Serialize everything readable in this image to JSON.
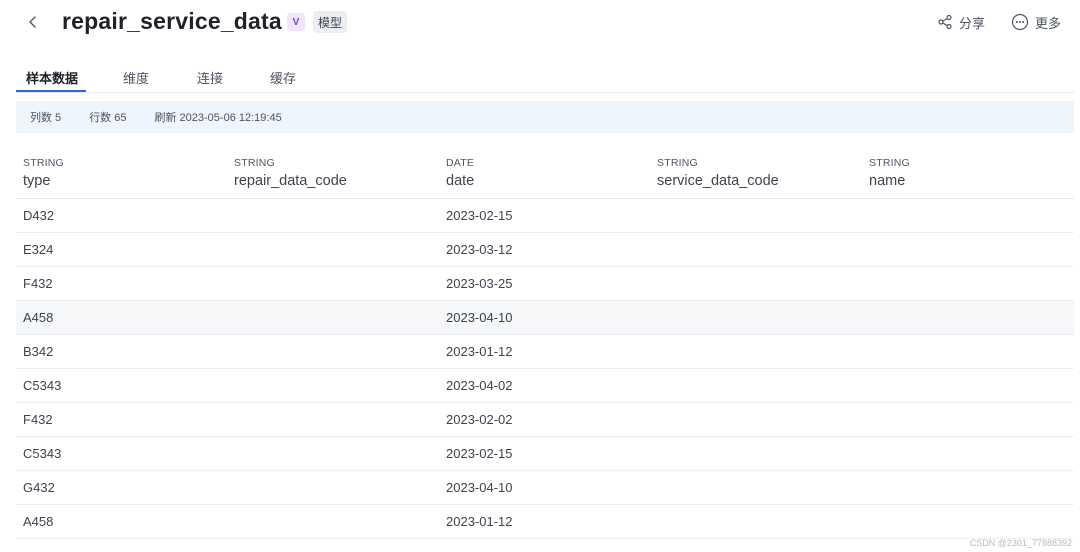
{
  "header": {
    "back_icon": "chevron-left-icon",
    "title": "repair_service_data",
    "badge": "V",
    "tag": "模型",
    "share_label": "分享",
    "share_icon": "share-icon",
    "more_label": "更多",
    "more_icon": "more-circle-icon"
  },
  "tabs": [
    {
      "label": "样本数据",
      "active": true
    },
    {
      "label": "维度",
      "active": false
    },
    {
      "label": "连接",
      "active": false
    },
    {
      "label": "缓存",
      "active": false
    }
  ],
  "info": {
    "columns": "列数 5",
    "rows": "行数 65",
    "refresh": "刷新 2023-05-06 12:19:45"
  },
  "table": {
    "columns": [
      {
        "type": "STRING",
        "name": "type"
      },
      {
        "type": "STRING",
        "name": "repair_data_code"
      },
      {
        "type": "DATE",
        "name": "date"
      },
      {
        "type": "STRING",
        "name": "service_data_code"
      },
      {
        "type": "STRING",
        "name": "name"
      }
    ],
    "rows": [
      [
        "D432",
        "",
        "2023-02-15",
        "",
        ""
      ],
      [
        "E324",
        "",
        "2023-03-12",
        "",
        ""
      ],
      [
        "F432",
        "",
        "2023-03-25",
        "",
        ""
      ],
      [
        "A458",
        "",
        "2023-04-10",
        "",
        ""
      ],
      [
        "B342",
        "",
        "2023-01-12",
        "",
        ""
      ],
      [
        "C5343",
        "",
        "2023-04-02",
        "",
        ""
      ],
      [
        "F432",
        "",
        "2023-02-02",
        "",
        ""
      ],
      [
        "C5343",
        "",
        "2023-02-15",
        "",
        ""
      ],
      [
        "G432",
        "",
        "2023-04-10",
        "",
        ""
      ],
      [
        "A458",
        "",
        "2023-01-12",
        "",
        ""
      ]
    ],
    "highlighted_row": 3
  },
  "watermark": "CSDN @2301_77888392",
  "colors": {
    "accent": "#2b6bd9",
    "badge_bg": "#efe6fb",
    "badge_fg": "#7a3fd6",
    "info_bg": "#eef5fc"
  }
}
